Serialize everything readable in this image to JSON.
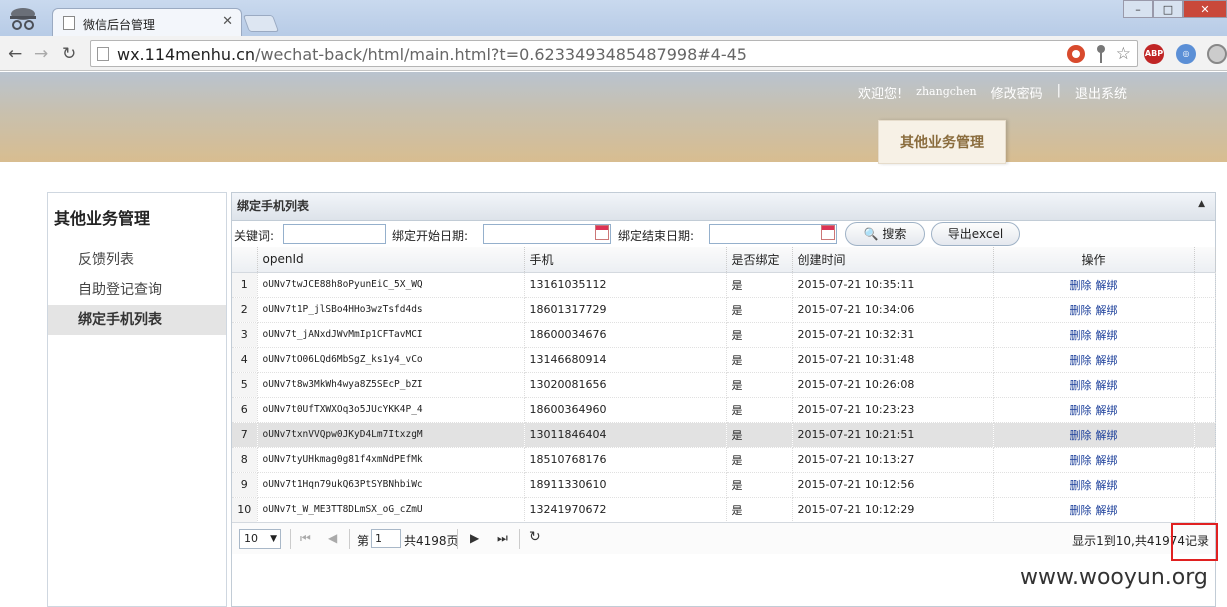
{
  "browser": {
    "tab_title": "微信后台管理",
    "url_host": "wx.114menhu.cn",
    "url_rest": "/wechat-back/html/main.html?t=0.6233493485487998#4-45"
  },
  "header": {
    "welcome": "欢迎您!",
    "username": "zhangchen",
    "change_password": "修改密码",
    "divider": "|",
    "logout": "退出系统",
    "module_tab": "其他业务管理"
  },
  "sidebar": {
    "title": "其他业务管理",
    "items": [
      {
        "label": "反馈列表"
      },
      {
        "label": "自助登记查询"
      },
      {
        "label": "绑定手机列表"
      }
    ]
  },
  "panel": {
    "title": "绑定手机列表",
    "search": {
      "keyword_label": "关键词:",
      "start_label": "绑定开始日期:",
      "end_label": "绑定结束日期:",
      "search_button": "搜索",
      "export_button": "导出excel"
    },
    "columns": [
      "openId",
      "手机",
      "是否绑定",
      "创建时间",
      "操作"
    ],
    "rows": [
      {
        "n": "1",
        "openid": "oUNv7twJCE88h8oPyunEiC_5X_WQ",
        "phone": "13161035112",
        "bound": "是",
        "created": "2015-07-21 10:35:11"
      },
      {
        "n": "2",
        "openid": "oUNv7t1P_jlSBo4HHo3wzTsfd4ds",
        "phone": "18601317729",
        "bound": "是",
        "created": "2015-07-21 10:34:06"
      },
      {
        "n": "3",
        "openid": "oUNv7t_jANxdJWvMmIp1CFTavMCI",
        "phone": "18600034676",
        "bound": "是",
        "created": "2015-07-21 10:32:31"
      },
      {
        "n": "4",
        "openid": "oUNv7tO06LQd6MbSgZ_ks1y4_vCo",
        "phone": "13146680914",
        "bound": "是",
        "created": "2015-07-21 10:31:48"
      },
      {
        "n": "5",
        "openid": "oUNv7t8w3MkWh4wya8Z5SEcP_bZI",
        "phone": "13020081656",
        "bound": "是",
        "created": "2015-07-21 10:26:08"
      },
      {
        "n": "6",
        "openid": "oUNv7t0UfTXWXOq3o5JUcYKK4P_4",
        "phone": "18600364960",
        "bound": "是",
        "created": "2015-07-21 10:23:23"
      },
      {
        "n": "7",
        "openid": "oUNv7txnVVQpw0JKyD4Lm7ItxzgM",
        "phone": "13011846404",
        "bound": "是",
        "created": "2015-07-21 10:21:51"
      },
      {
        "n": "8",
        "openid": "oUNv7tyUHkmag0g81f4xmNdPEfMk",
        "phone": "18510768176",
        "bound": "是",
        "created": "2015-07-21 10:13:27"
      },
      {
        "n": "9",
        "openid": "oUNv7t1Hqn79ukQ63PtSYBNhbiWc",
        "phone": "18911330610",
        "bound": "是",
        "created": "2015-07-21 10:12:56"
      },
      {
        "n": "10",
        "openid": "oUNv7t_W_ME3TT8DLmSX_oG_cZmU",
        "phone": "13241970672",
        "bound": "是",
        "created": "2015-07-21 10:12:29"
      }
    ],
    "row_actions": {
      "delete": "删除",
      "unbind": "解绑"
    },
    "pager": {
      "page_size": "10",
      "page_prefix": "第",
      "current_page": "1",
      "page_total": "共4198页",
      "info": "显示1到10,共41974记录"
    }
  },
  "watermark": "www.wooyun.org",
  "colors": {
    "accent_link": "#1a3e9a",
    "highlight_box": "#e02020"
  }
}
